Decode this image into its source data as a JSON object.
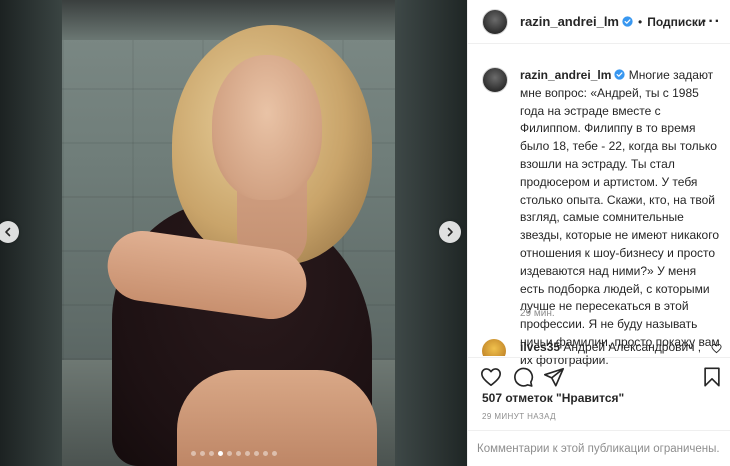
{
  "post": {
    "username": "razin_andrei_lm",
    "follow_label": "Подписки",
    "separator": "•",
    "more_label": "···",
    "caption": {
      "username": "razin_andrei_lm",
      "text": " Многие задают мне вопрос: «Андрей, ты с 1985 года на эстраде вместе с Филиппом. Филиппу в то время было 18, тебе - 22, когда вы только взошли на эстраду. Ты стал продюсером и артистом. У тебя столько опыта. Скажи, кто, на твой взгляд, самые сомнительные звезды, которые не имеют никакого отношения к шоу-бизнесу и просто издеваются над ними?» У меня есть подборка людей, с которыми лучше не пересекаться в этой профессии. Я не буду называть ничьи фамилии, просто покажу вам их фотографии.",
      "time": "29 мин."
    },
    "comment": {
      "username": "ilves35",
      "text": " Андрей Александрович ,"
    },
    "likes": "507 отметок \"Нравится\"",
    "time_ago": "29 МИНУТ НАЗАД",
    "comments_disabled": "Комментарии к этой публикации ограничены."
  },
  "carousel": {
    "total_slides": 10,
    "active_slide": 4
  },
  "icons": {
    "verified": "verified-badge-icon",
    "like": "heart-icon",
    "comment": "comment-icon",
    "share": "share-icon",
    "save": "bookmark-icon",
    "prev": "chevron-left-icon",
    "next": "chevron-right-icon"
  },
  "colors": {
    "verified_blue": "#3897f0",
    "text_primary": "#262626",
    "text_secondary": "#8e8e8e"
  }
}
